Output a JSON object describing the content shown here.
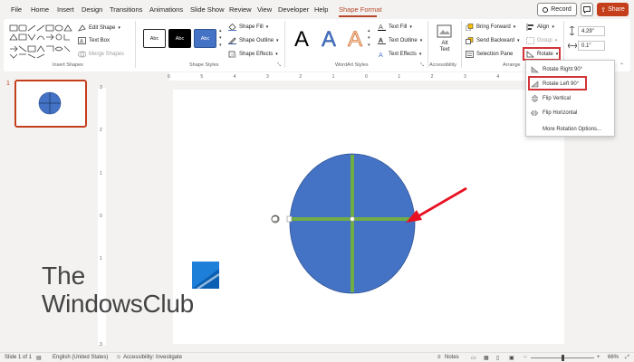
{
  "tabs": [
    {
      "label": "File"
    },
    {
      "label": "Home"
    },
    {
      "label": "Insert"
    },
    {
      "label": "Design"
    },
    {
      "label": "Transitions"
    },
    {
      "label": "Animations"
    },
    {
      "label": "Slide Show"
    },
    {
      "label": "Review"
    },
    {
      "label": "View"
    },
    {
      "label": "Developer"
    },
    {
      "label": "Help"
    },
    {
      "label": "Shape Format"
    }
  ],
  "header": {
    "record_label": "Record",
    "share_label": "Share"
  },
  "ribbon": {
    "insert_shapes": {
      "edit_shape": "Edit Shape",
      "text_box": "Text Box",
      "merge_shapes": "Merge Shapes",
      "group_label": "Insert Shapes"
    },
    "shape_styles": {
      "presets": [
        {
          "label": "Abc",
          "bg": "#ffffff",
          "fg": "#252423",
          "border": "#252423"
        },
        {
          "label": "Abc",
          "bg": "#000000",
          "fg": "#ffffff",
          "border": "#000000"
        },
        {
          "label": "Abc",
          "bg": "#4472c4",
          "fg": "#ffffff",
          "border": "#2f5597"
        }
      ],
      "shape_fill": "Shape Fill",
      "shape_outline": "Shape Outline",
      "shape_effects": "Shape Effects",
      "group_label": "Shape Styles"
    },
    "wordart": {
      "letters": [
        {
          "char": "A",
          "color": "#000000"
        },
        {
          "char": "A",
          "color": "#4472c4"
        },
        {
          "char": "A",
          "color": "#ed7d31"
        }
      ],
      "text_fill": "Text Fill",
      "text_outline": "Text Outline",
      "text_effects": "Text Effects",
      "group_label": "WordArt Styles"
    },
    "accessibility": {
      "alt_text_line1": "Alt",
      "alt_text_line2": "Text",
      "group_label": "Accessibility"
    },
    "arrange": {
      "bring_forward": "Bring Forward",
      "send_backward": "Send Backward",
      "selection_pane": "Selection Pane",
      "align": "Align",
      "group": "Group",
      "rotate": "Rotate",
      "group_label": "Arrange"
    },
    "size": {
      "height": "4.29\"",
      "width": "0.1\""
    }
  },
  "rotate_menu": {
    "items": [
      {
        "label": "Rotate Right 90°"
      },
      {
        "label": "Rotate Left 90°"
      },
      {
        "label": "Flip Vertical"
      },
      {
        "label": "Flip Horizontal"
      },
      {
        "label": "More Rotation Options..."
      }
    ]
  },
  "slides_pane": {
    "slide_number": "1"
  },
  "ruler": {
    "h_ticks": [
      "6",
      "5",
      "4",
      "3",
      "2",
      "1",
      "0",
      "1",
      "2",
      "3",
      "4",
      "5",
      "6"
    ],
    "v_ticks": [
      "3",
      "2",
      "1",
      "0",
      "1",
      "2",
      "3"
    ]
  },
  "watermark": {
    "line1": "The",
    "line2": "WindowsClub"
  },
  "status": {
    "slide_info": "Slide 1 of 1",
    "language": "English (United States)",
    "accessibility": "Accessibility: Investigate",
    "notes": "Notes",
    "zoom": "66%"
  },
  "colors": {
    "accent": "#b7472a",
    "share": "#c43e1c",
    "circle_fill": "#4472c4",
    "circle_stroke": "#2f5597",
    "line_green": "#70ad47",
    "arrow_red": "#e81123",
    "highlight_red": "#d13438"
  }
}
